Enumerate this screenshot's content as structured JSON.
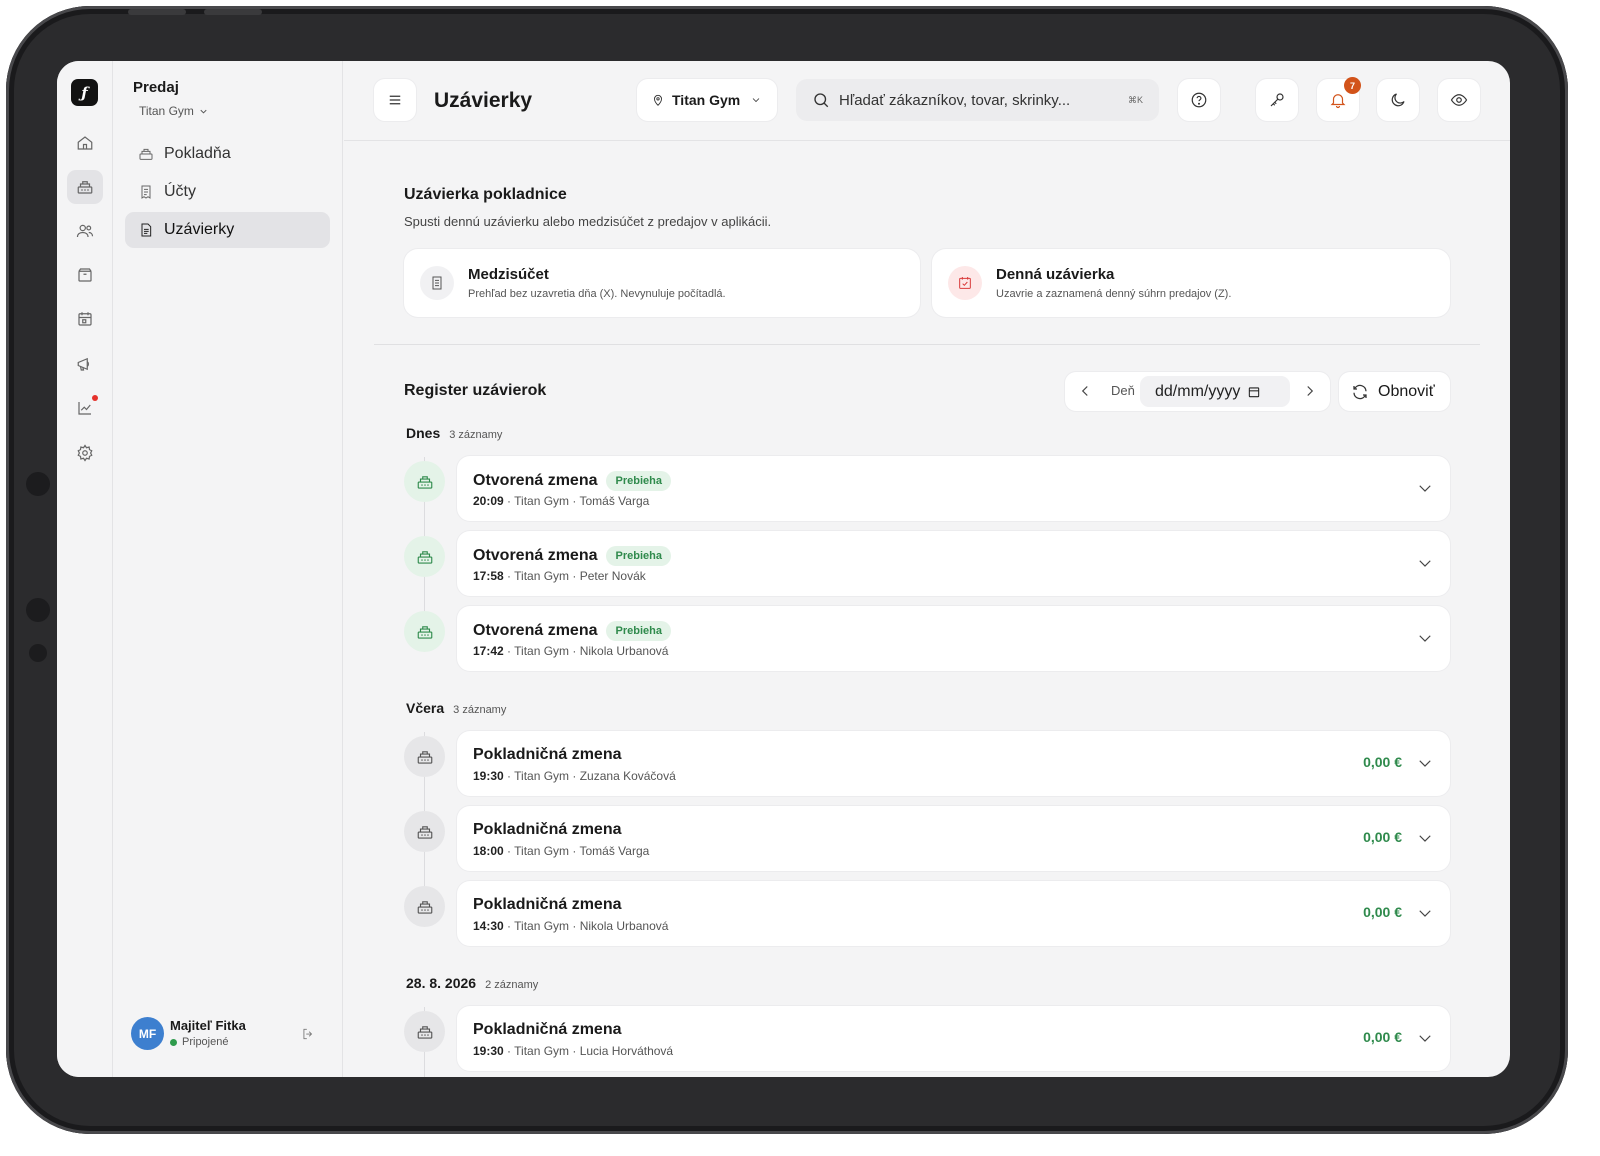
{
  "sidebar": {
    "title": "Predaj",
    "location": "Titan Gym",
    "items": [
      {
        "label": "Pokladňa"
      },
      {
        "label": "Účty"
      },
      {
        "label": "Uzávierky"
      }
    ],
    "user": {
      "initials": "MF",
      "name": "Majiteľ Fitka",
      "status": "Pripojené"
    }
  },
  "header": {
    "title": "Uzávierky",
    "location": "Titan Gym",
    "search_placeholder": "Hľadať zákazníkov, tovar, skrinky...",
    "search_shortcut": "⌘K",
    "notification_count": "7"
  },
  "closing": {
    "title": "Uzávierka pokladnice",
    "description": "Spusti dennú uzávierku alebo medzisúčet z predajov v aplikácii.",
    "subtotal": {
      "title": "Medzisúčet",
      "description": "Prehľad bez uzavretia dňa (X). Nevynuluje počítadlá."
    },
    "daily": {
      "title": "Denná uzávierka",
      "description": "Uzavrie a zaznamená denný súhrn predajov (Z)."
    }
  },
  "register": {
    "title": "Register uzávierok",
    "period_label": "Deň",
    "date_placeholder": "dd/mm/yyyy",
    "refresh_label": "Obnoviť",
    "groups": [
      {
        "label": "Dnes",
        "count": "3 záznamy",
        "entries": [
          {
            "title": "Otvorená zmena",
            "badge": "Prebieha",
            "time": "20:09",
            "meta": " · Titan Gym · Tomáš Varga"
          },
          {
            "title": "Otvorená zmena",
            "badge": "Prebieha",
            "time": "17:58",
            "meta": " · Titan Gym · Peter Novák"
          },
          {
            "title": "Otvorená zmena",
            "badge": "Prebieha",
            "time": "17:42",
            "meta": " · Titan Gym · Nikola Urbanová"
          }
        ]
      },
      {
        "label": "Včera",
        "count": "3 záznamy",
        "entries": [
          {
            "title": "Pokladničná zmena",
            "amount": "0,00 €",
            "time": "19:30",
            "meta": " · Titan Gym · Zuzana Kováčová"
          },
          {
            "title": "Pokladničná zmena",
            "amount": "0,00 €",
            "time": "18:00",
            "meta": " · Titan Gym · Tomáš Varga"
          },
          {
            "title": "Pokladničná zmena",
            "amount": "0,00 €",
            "time": "14:30",
            "meta": " · Titan Gym · Nikola Urbanová"
          }
        ]
      },
      {
        "label": "28. 8. 2026",
        "count": "2 záznamy",
        "entries": [
          {
            "title": "Pokladničná zmena",
            "amount": "0,00 €",
            "time": "19:30",
            "meta": " · Titan Gym · Lucia Horváthová"
          }
        ]
      }
    ]
  },
  "colors": {
    "accent_green": "#2f8a4c",
    "notification": "#d2531a",
    "avatar": "#3d7fcf"
  }
}
